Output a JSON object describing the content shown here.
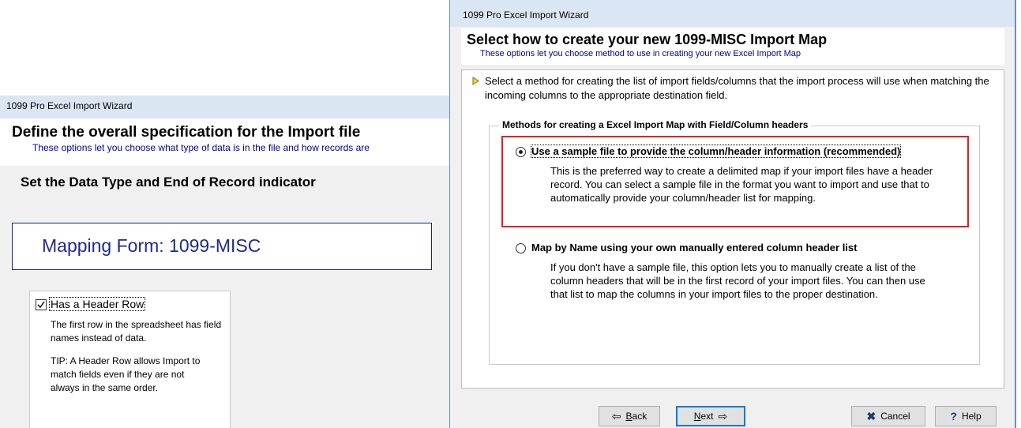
{
  "back_window": {
    "title": "1099 Pro Excel Import Wizard",
    "header_title": "Define the overall specification for the Import file",
    "header_subtitle": "These options let you choose what type of data is in the file and how records are",
    "section_title": "Set the Data Type and End of Record indicator",
    "mapping_form": "Mapping Form: 1099-MISC",
    "header_row": {
      "label": "Has a Header Row",
      "checked": true,
      "description": "The first row in the spreadsheet has field names instead of data.",
      "tip": "TIP: A Header Row allows Import to match fields even if they are not always in the same order."
    }
  },
  "front_window": {
    "title": "1099 Pro Excel Import Wizard",
    "header_title": "Select how to create your new 1099-MISC Import Map",
    "header_subtitle": "These options let you choose method to use in creating your new  Excel Import Map",
    "intro": "Select a method for creating the list of import fields/columns that the import process will use when matching the incoming columns to the appropriate destination field.",
    "group_title": "Methods for creating a Excel Import Map with Field/Column headers",
    "options": [
      {
        "label": "Use a sample file to provide the column/header information  (recommended)",
        "selected": true,
        "description": "This is the preferred way to create a delimited map if your import files have a header record.  You can select a sample file in the format you want to import and use that to automatically provide your column/header list for mapping."
      },
      {
        "label": "Map by Name using your own manually entered column header list",
        "selected": false,
        "description": "If you don't have a sample file, this option lets you to manually create a list of the column headers that will be in the first record of your import files.  You can then use that list to map the columns in your import files to the proper destination."
      }
    ],
    "buttons": {
      "back": "ack",
      "back_accel": "B",
      "next": "ext",
      "next_accel": "N",
      "cancel": "Cancel",
      "help": "Help"
    },
    "highlight_color": "#e0202a"
  },
  "colors": {
    "title_bar": "#dbe6f4",
    "header_subtitle": "#00008b",
    "mapping_form_text": "#1f2a8c",
    "window_border": "#6f8db5"
  }
}
